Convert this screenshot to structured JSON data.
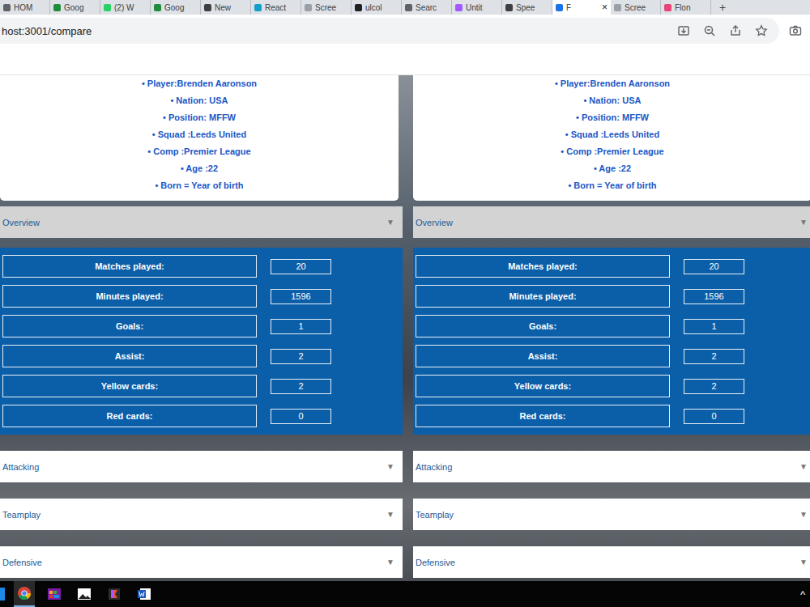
{
  "browser": {
    "tabs": [
      {
        "label": "HOM",
        "selected": false,
        "color": "#5f6368"
      },
      {
        "label": "Goog",
        "selected": false,
        "color": "#1e8e3e"
      },
      {
        "label": "(2) W",
        "selected": false,
        "color": "#25d366"
      },
      {
        "label": "Goog",
        "selected": false,
        "color": "#1e8e3e"
      },
      {
        "label": "New",
        "selected": false,
        "color": "#3c4043"
      },
      {
        "label": "React",
        "selected": false,
        "color": "#149eca"
      },
      {
        "label": "Scree",
        "selected": false,
        "color": "#9aa0a6"
      },
      {
        "label": "ulcol",
        "selected": false,
        "color": "#202124"
      },
      {
        "label": "Searc",
        "selected": false,
        "color": "#5f6368"
      },
      {
        "label": "Untit",
        "selected": false,
        "color": "#a259ff"
      },
      {
        "label": "Spee",
        "selected": false,
        "color": "#3c4043"
      },
      {
        "label": "F",
        "selected": true,
        "color": "#1a73e8"
      },
      {
        "label": "Scree",
        "selected": false,
        "color": "#9aa0a6"
      },
      {
        "label": "Flon",
        "selected": false,
        "color": "#e8437a"
      }
    ],
    "active_close": "×",
    "new_tab": "+",
    "address": "host:3001/compare"
  },
  "columns": [
    {
      "profile": [
        "• Player:Brenden Aaronson",
        "• Nation: USA",
        "• Position: MFFW",
        "• Squad :Leeds United",
        "• Comp :Premier League",
        "• Age :22",
        "• Born = Year of birth"
      ],
      "sections": [
        {
          "title": "Overview",
          "expanded": true,
          "chevron": "▼",
          "stats": [
            {
              "label": "Matches played:",
              "value": "20"
            },
            {
              "label": "Minutes played:",
              "value": "1596"
            },
            {
              "label": "Goals:",
              "value": "1"
            },
            {
              "label": "Assist:",
              "value": "2"
            },
            {
              "label": "Yellow cards:",
              "value": "2"
            },
            {
              "label": "Red cards:",
              "value": "0"
            }
          ]
        },
        {
          "title": "Attacking",
          "expanded": false,
          "chevron": "▼",
          "stats": []
        },
        {
          "title": "Teamplay",
          "expanded": false,
          "chevron": "▼",
          "stats": []
        },
        {
          "title": "Defensive",
          "expanded": false,
          "chevron": "▼",
          "stats": []
        }
      ]
    },
    {
      "profile": [
        "• Player:Brenden Aaronson",
        "• Nation: USA",
        "• Position: MFFW",
        "• Squad :Leeds United",
        "• Comp :Premier League",
        "• Age :22",
        "• Born = Year of birth"
      ],
      "sections": [
        {
          "title": "Overview",
          "expanded": true,
          "chevron": "▼",
          "stats": [
            {
              "label": "Matches played:",
              "value": "20"
            },
            {
              "label": "Minutes played:",
              "value": "1596"
            },
            {
              "label": "Goals:",
              "value": "1"
            },
            {
              "label": "Assist:",
              "value": "2"
            },
            {
              "label": "Yellow cards:",
              "value": "2"
            },
            {
              "label": "Red cards:",
              "value": "0"
            }
          ]
        },
        {
          "title": "Attacking",
          "expanded": false,
          "chevron": "▼",
          "stats": []
        },
        {
          "title": "Teamplay",
          "expanded": false,
          "chevron": "▼",
          "stats": []
        },
        {
          "title": "Defensive",
          "expanded": false,
          "chevron": "▼",
          "stats": []
        }
      ]
    }
  ],
  "taskbar": {
    "tray": "^"
  }
}
